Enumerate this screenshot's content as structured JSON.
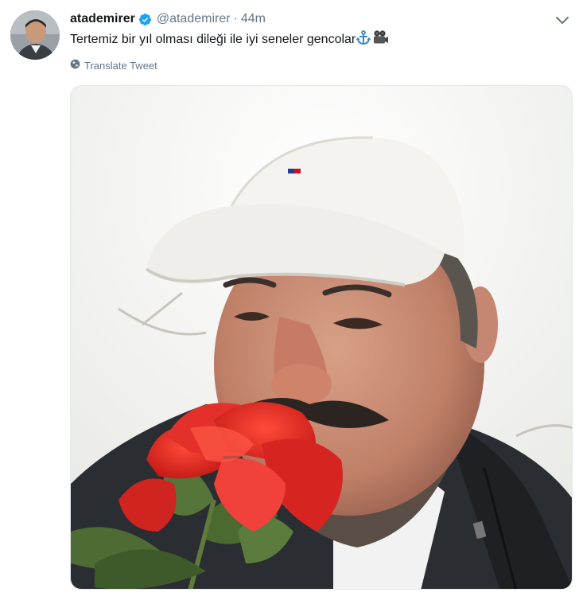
{
  "tweet": {
    "display_name": "atademirer",
    "handle": "@atademirer",
    "separator": "·",
    "time": "44m",
    "text": "Tertemiz bir yıl olması dileği ile iyi seneler gencolar",
    "translate_label": "Translate Tweet"
  },
  "icons": {
    "verified": "verified-badge-icon",
    "caret": "chevron-down-icon",
    "translate": "globe-icon",
    "emoji_1": "anchor-icon",
    "emoji_2": "movie-camera-icon"
  },
  "colors": {
    "name": "#14171a",
    "secondary": "#657786",
    "verified": "#1da1f2"
  }
}
